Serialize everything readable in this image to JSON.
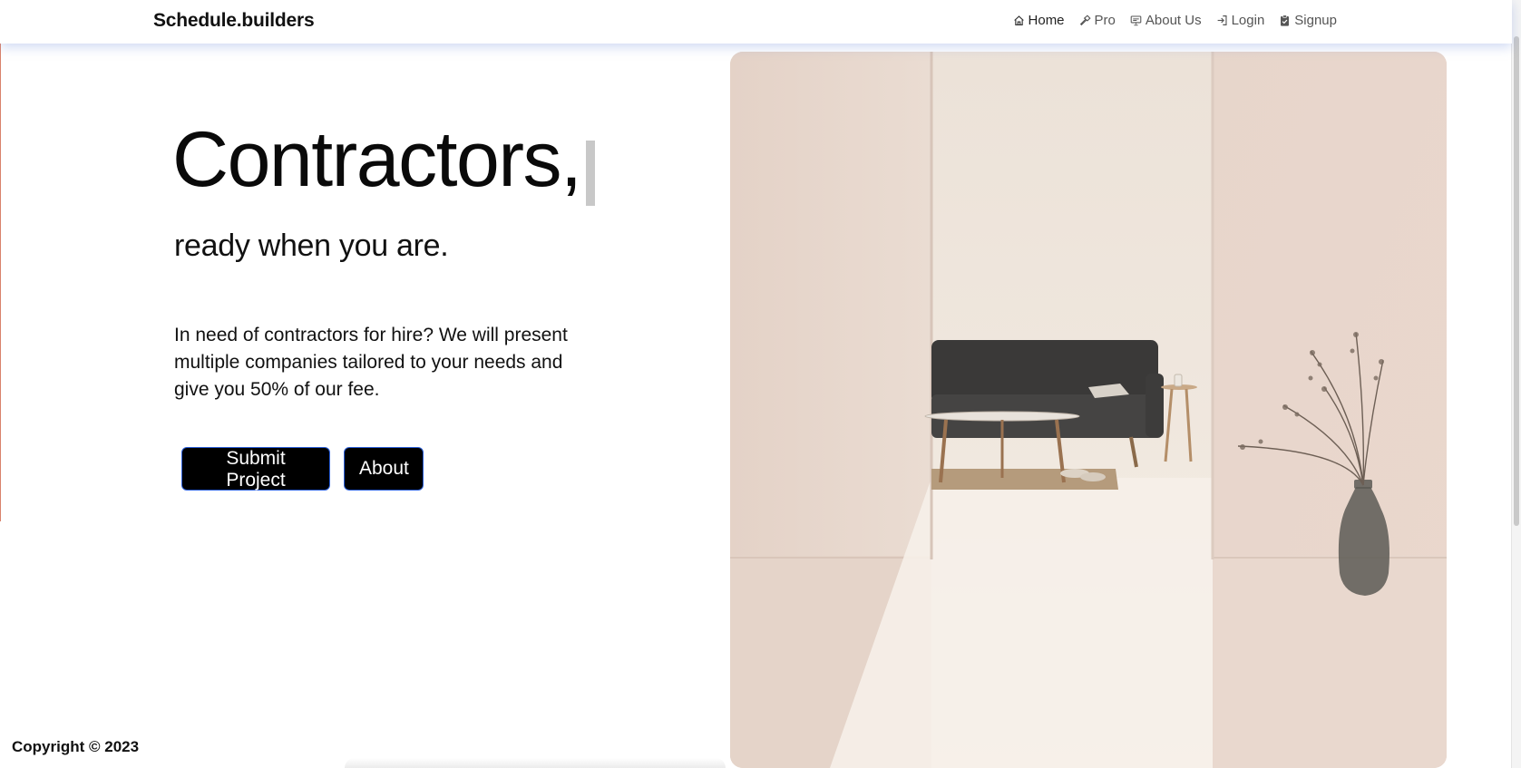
{
  "brand": "Schedule.builders",
  "nav": {
    "home": "Home",
    "pro": "Pro",
    "about_us": "About Us",
    "login": "Login",
    "signup": "Signup"
  },
  "hero": {
    "title": "Contractors,",
    "subtitle": "ready when you are.",
    "body": "In need of contractors for hire? We will present multiple companies tailored to your needs and give you 50% of our fee.",
    "submit_button": "Submit Project",
    "about_button": "About"
  },
  "footer": {
    "copyright": "Copyright © 2023"
  },
  "colors": {
    "button_bg": "#000000",
    "button_border": "#2b5fd9",
    "navbar_shadow": "#7896dc"
  },
  "icons": {
    "home": "home-icon",
    "pro": "hammer-icon",
    "about_us": "presentation-icon",
    "login": "login-icon",
    "signup": "clipboard-check-icon"
  }
}
